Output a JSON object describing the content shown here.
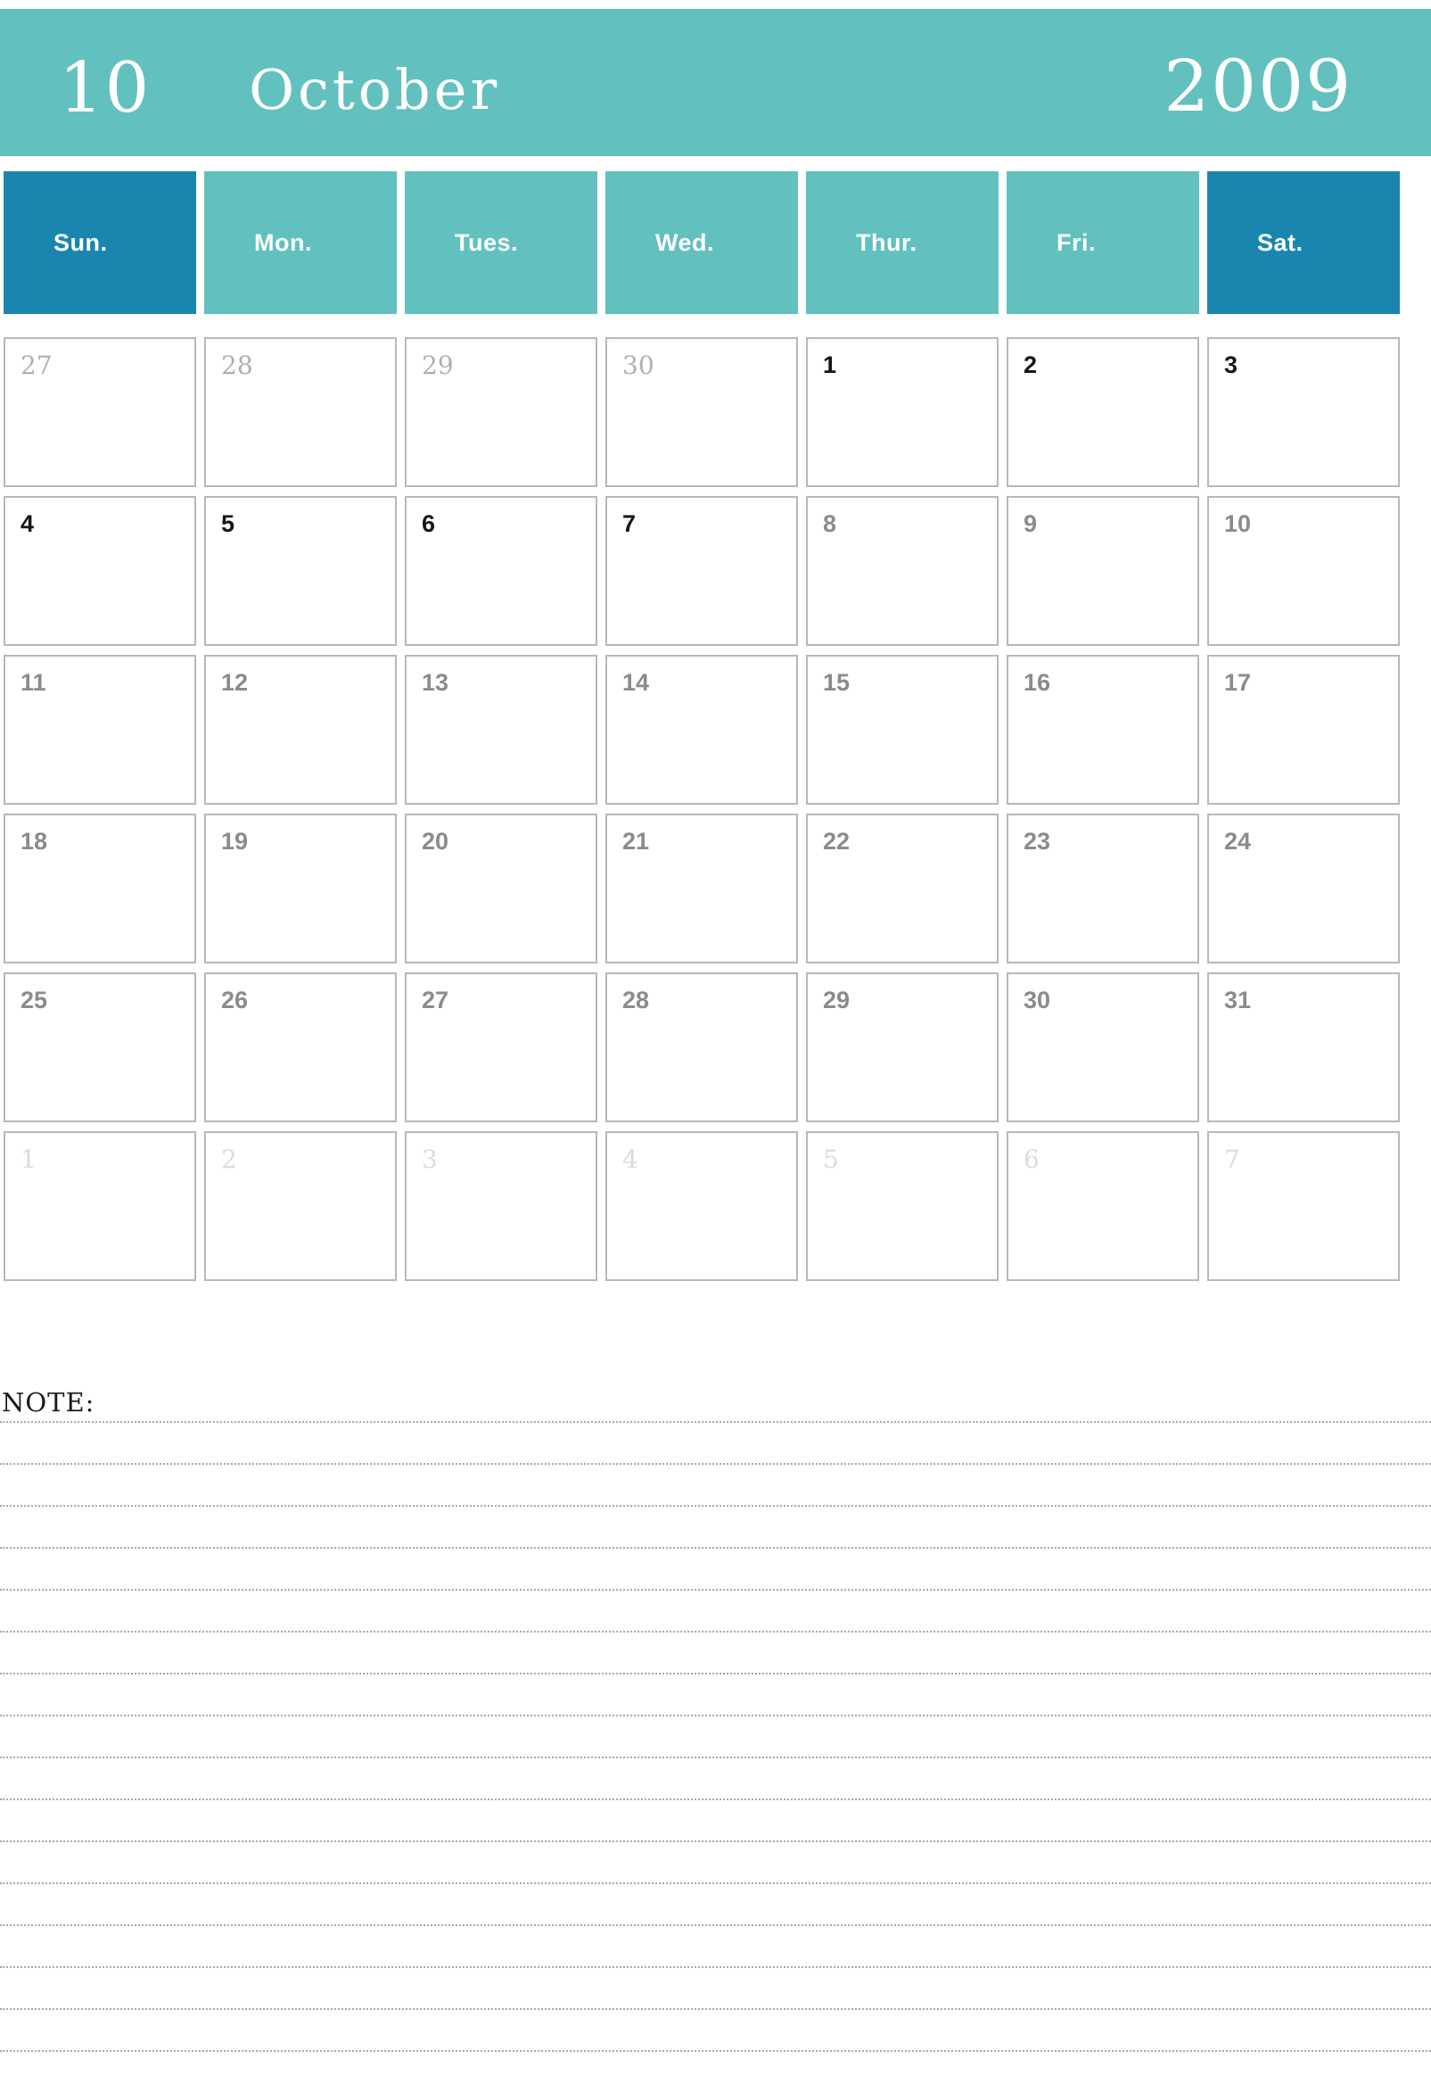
{
  "header": {
    "month_number": "10",
    "month_name": "October",
    "year": "2009",
    "banner_color": "#62c1bf",
    "weekend_color": "#1a86b0"
  },
  "weekdays": [
    {
      "label": "Sun.",
      "weekend": true
    },
    {
      "label": "Mon.",
      "weekend": false
    },
    {
      "label": "Tues.",
      "weekend": false
    },
    {
      "label": "Wed.",
      "weekend": false
    },
    {
      "label": "Thur.",
      "weekend": false
    },
    {
      "label": "Fri.",
      "weekend": false
    },
    {
      "label": "Sat.",
      "weekend": true
    }
  ],
  "weeks": [
    [
      {
        "num": "27",
        "kind": "prev"
      },
      {
        "num": "28",
        "kind": "prev"
      },
      {
        "num": "29",
        "kind": "prev"
      },
      {
        "num": "30",
        "kind": "prev"
      },
      {
        "num": "1",
        "kind": "cur"
      },
      {
        "num": "2",
        "kind": "cur"
      },
      {
        "num": "3",
        "kind": "cur"
      }
    ],
    [
      {
        "num": "4",
        "kind": "cur"
      },
      {
        "num": "5",
        "kind": "cur"
      },
      {
        "num": "6",
        "kind": "cur"
      },
      {
        "num": "7",
        "kind": "cur"
      },
      {
        "num": "8",
        "kind": "dim"
      },
      {
        "num": "9",
        "kind": "dim"
      },
      {
        "num": "10",
        "kind": "dim"
      }
    ],
    [
      {
        "num": "11",
        "kind": "dim"
      },
      {
        "num": "12",
        "kind": "dim"
      },
      {
        "num": "13",
        "kind": "dim"
      },
      {
        "num": "14",
        "kind": "dim"
      },
      {
        "num": "15",
        "kind": "dim"
      },
      {
        "num": "16",
        "kind": "dim"
      },
      {
        "num": "17",
        "kind": "dim"
      }
    ],
    [
      {
        "num": "18",
        "kind": "dim"
      },
      {
        "num": "19",
        "kind": "dim"
      },
      {
        "num": "20",
        "kind": "dim"
      },
      {
        "num": "21",
        "kind": "dim"
      },
      {
        "num": "22",
        "kind": "dim"
      },
      {
        "num": "23",
        "kind": "dim"
      },
      {
        "num": "24",
        "kind": "dim"
      }
    ],
    [
      {
        "num": "25",
        "kind": "dim"
      },
      {
        "num": "26",
        "kind": "dim"
      },
      {
        "num": "27",
        "kind": "dim"
      },
      {
        "num": "28",
        "kind": "dim"
      },
      {
        "num": "29",
        "kind": "dim"
      },
      {
        "num": "30",
        "kind": "dim"
      },
      {
        "num": "31",
        "kind": "dim"
      }
    ],
    [
      {
        "num": "1",
        "kind": "next"
      },
      {
        "num": "2",
        "kind": "next"
      },
      {
        "num": "3",
        "kind": "next"
      },
      {
        "num": "4",
        "kind": "next"
      },
      {
        "num": "5",
        "kind": "next"
      },
      {
        "num": "6",
        "kind": "next"
      },
      {
        "num": "7",
        "kind": "next"
      }
    ]
  ],
  "note": {
    "label": "NOTE:",
    "line_count": 16
  }
}
